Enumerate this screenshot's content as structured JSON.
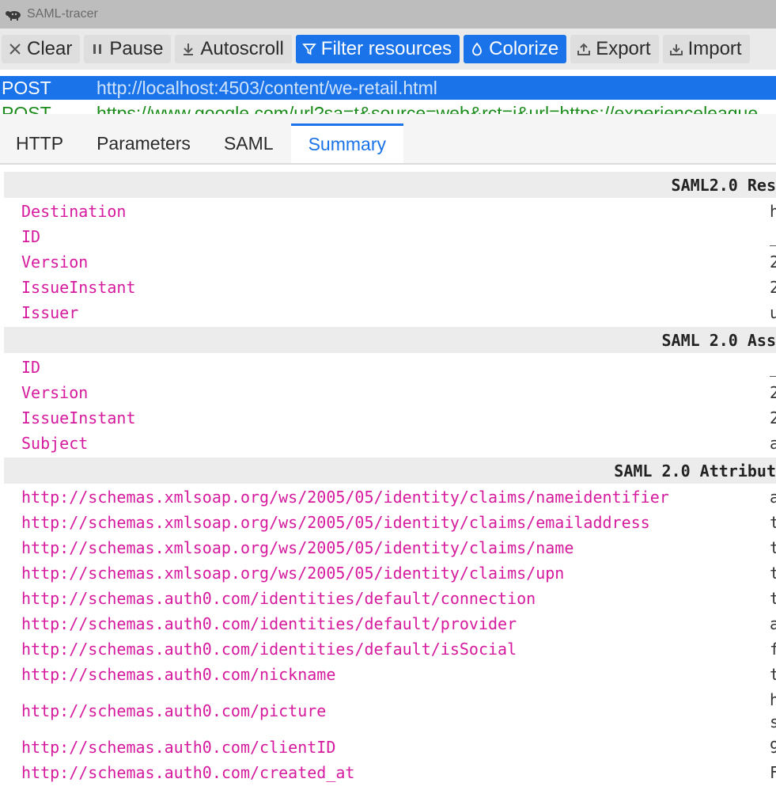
{
  "window": {
    "title": "SAML-tracer"
  },
  "toolbar": {
    "buttons": [
      {
        "label": "Clear",
        "icon": "close-icon"
      },
      {
        "label": "Pause",
        "icon": "pause-icon"
      },
      {
        "label": "Autoscroll",
        "icon": "download-arrow-icon"
      },
      {
        "label": "Filter resources",
        "icon": "filter-icon",
        "active": true
      },
      {
        "label": "Colorize",
        "icon": "droplet-icon",
        "active": true
      },
      {
        "label": "Export",
        "icon": "export-icon"
      },
      {
        "label": "Import",
        "icon": "import-icon"
      }
    ]
  },
  "requests": [
    {
      "method": "POST",
      "url": "http://localhost:4503/content/we-retail.html",
      "selected": true
    },
    {
      "method": "POST",
      "url": "https://www.google.com/url?sa=t&source=web&rct=j&url=https://experienceleague",
      "selected": false
    }
  ],
  "tabs": [
    {
      "label": "HTTP"
    },
    {
      "label": "Parameters"
    },
    {
      "label": "SAML"
    },
    {
      "label": "Summary",
      "active": true
    }
  ],
  "summary": {
    "response": {
      "heading": "SAML2.0 Res",
      "rows": [
        {
          "key": "Destination",
          "value": "h"
        },
        {
          "key": "ID",
          "value": "_"
        },
        {
          "key": "Version",
          "value": "2"
        },
        {
          "key": "IssueInstant",
          "value": "2"
        },
        {
          "key": "Issuer",
          "value": "u"
        }
      ]
    },
    "assertion": {
      "heading": "SAML 2.0 Ass",
      "rows": [
        {
          "key": "ID",
          "value": "_"
        },
        {
          "key": "Version",
          "value": "2"
        },
        {
          "key": "IssueInstant",
          "value": "2"
        },
        {
          "key": "Subject",
          "value": "a"
        }
      ]
    },
    "attributes": {
      "heading": "SAML 2.0 Attribut",
      "rows": [
        {
          "key": "http://schemas.xmlsoap.org/ws/2005/05/identity/claims/nameidentifier",
          "value": "a"
        },
        {
          "key": "http://schemas.xmlsoap.org/ws/2005/05/identity/claims/emailaddress",
          "value": "t"
        },
        {
          "key": "http://schemas.xmlsoap.org/ws/2005/05/identity/claims/name",
          "value": "t"
        },
        {
          "key": "http://schemas.xmlsoap.org/ws/2005/05/identity/claims/upn",
          "value": "t"
        },
        {
          "key": "http://schemas.auth0.com/identities/default/connection",
          "value": "t"
        },
        {
          "key": "http://schemas.auth0.com/identities/default/provider",
          "value": "a"
        },
        {
          "key": "http://schemas.auth0.com/identities/default/isSocial",
          "value": "f"
        },
        {
          "key": "http://schemas.auth0.com/nickname",
          "value": "t"
        },
        {
          "key": "http://schemas.auth0.com/picture",
          "value": "h",
          "value2": "s"
        },
        {
          "key": "http://schemas.auth0.com/clientID",
          "value": "9"
        },
        {
          "key": "http://schemas.auth0.com/created_at",
          "value": "F"
        }
      ]
    }
  }
}
